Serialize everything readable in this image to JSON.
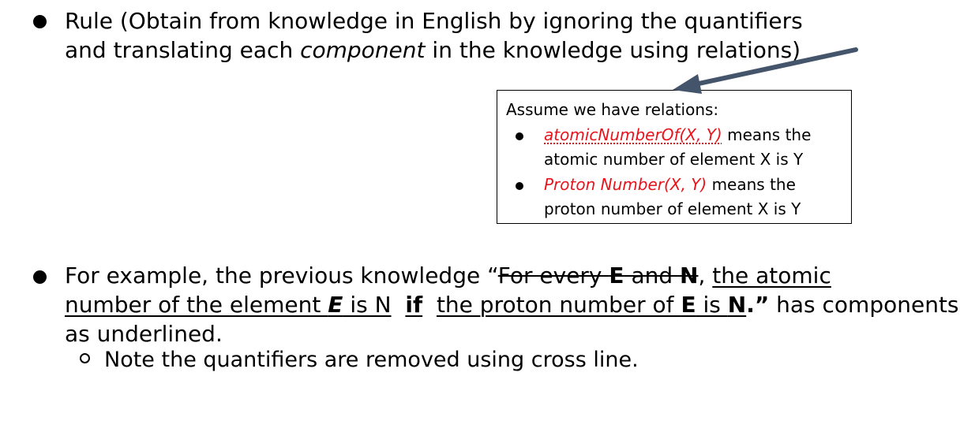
{
  "bullet1": {
    "line1": "Rule (Obtain from knowledge in English by ignoring the quantifiers",
    "line2_a": "and translating each ",
    "line2_italic": "component",
    "line2_b": " in the knowledge using relations)"
  },
  "callout": {
    "heading": "Assume we have relations:",
    "item1_rel": "atomicNumberOf(X, Y)",
    "item1_text_a": " means the",
    "item1_text_b": "atomic number of element X is Y",
    "item2_rel": "Proton Number(X, Y)",
    "item2_text_a": " means the",
    "item2_text_b": "proton number of element X is Y",
    "rel_color": "#e8141c",
    "arrow_color": "#44546a"
  },
  "bullet2": {
    "open": "For example, the previous knowledge “",
    "quant_a": "For every ",
    "quant_E": "E",
    "quant_and": " and ",
    "quant_N": "N",
    "comma": ", ",
    "comp1_a": "the atomic",
    "comp1_b": "number of the element ",
    "comp1_E": "E",
    "comp1_c": "  is N",
    "gap1": "  ",
    "if": "if",
    "gap2": "  ",
    "comp2_a": "the proton number of ",
    "comp2_E": "E",
    "comp2_is": " is ",
    "comp2_N": "N",
    "close": ".”",
    "tail": " has components",
    "line3": "as underlined."
  },
  "sub_bullet": {
    "text": "Note the quantifiers are removed using cross line."
  }
}
